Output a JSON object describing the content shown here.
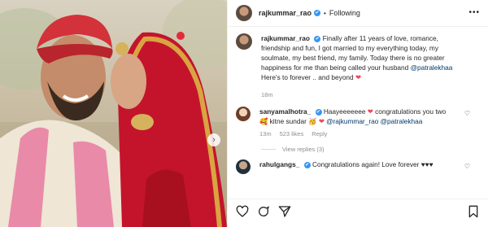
{
  "header": {
    "username": "rajkummar_rao",
    "verified_mark": "✔",
    "separator": "•",
    "follow_status": "Following",
    "more_label": "•••"
  },
  "caption": {
    "username": "rajkummar_rao",
    "text": "Finally after 11 years of love, romance, friendship and fun, I got married to my everything today, my soulmate, my best friend, my family. Today there is no greater happiness for me than being called your husband",
    "mention": "@patralekhaa",
    "line2": "Here's to forever .. and beyond",
    "emoji": "❤",
    "time": "18m"
  },
  "comments": [
    {
      "username": "sanyamalhotra_",
      "text_a": "Haayeeeeeee",
      "emoji_a": "❤",
      "text_b": "congratulations you two",
      "emoji_b": "🥰",
      "text_c": "kitne sundar",
      "emoji_c": "🥳",
      "emoji_d": "❤",
      "mentions": "@rajkummar_rao @patralekhaa",
      "time": "13m",
      "likes": "523 likes",
      "reply": "Reply",
      "view_replies": "View replies (3)"
    },
    {
      "username": "rahulgangs_",
      "text": "Congratulations again! Love forever ♥♥♥"
    }
  ],
  "icons": {
    "like": "heart-outline-icon",
    "comment": "comment-icon",
    "share": "paper-plane-icon",
    "save": "bookmark-icon",
    "next": "chevron-right-icon"
  },
  "next_arrow": "›",
  "like_glyph": "♡"
}
